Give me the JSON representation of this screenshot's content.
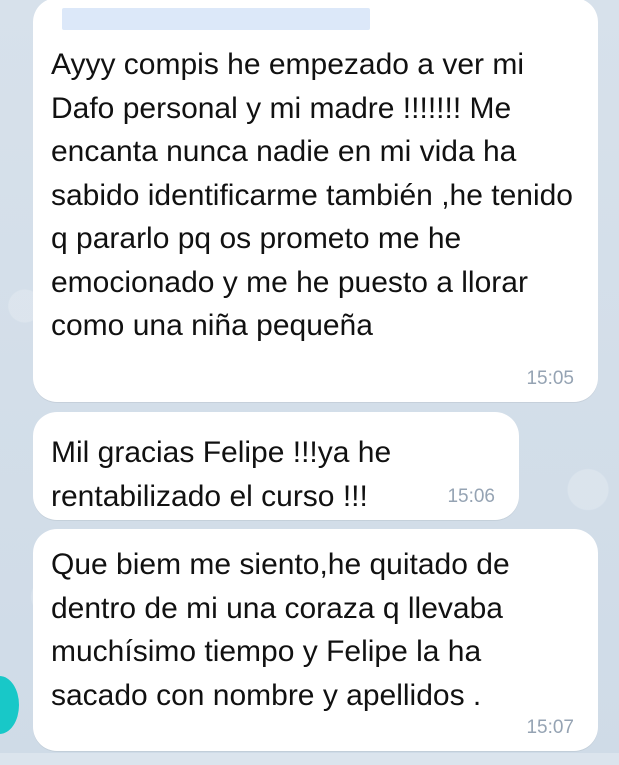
{
  "chat": {
    "background_color": "#d6e0ea",
    "messages": [
      {
        "text": "Ayyy compis he empezado a ver mi Dafo personal y mi madre !!!!!!! Me encanta nunca nadie en mi vida ha sabido identificarme también ,he tenido q pararlo pq os prometo me he emocionado y me he puesto a llorar como una niña pequeña",
        "time": "15:05"
      },
      {
        "text": "Mil gracias Felipe !!!ya he rentabilizado el curso !!!",
        "time": "15:06"
      },
      {
        "text": "Que biem me siento,he quitado de dentro de mi una coraza q llevaba muchísimo tiempo y Felipe la ha sacado con nombre y apellidos .",
        "time": "15:07"
      }
    ]
  }
}
